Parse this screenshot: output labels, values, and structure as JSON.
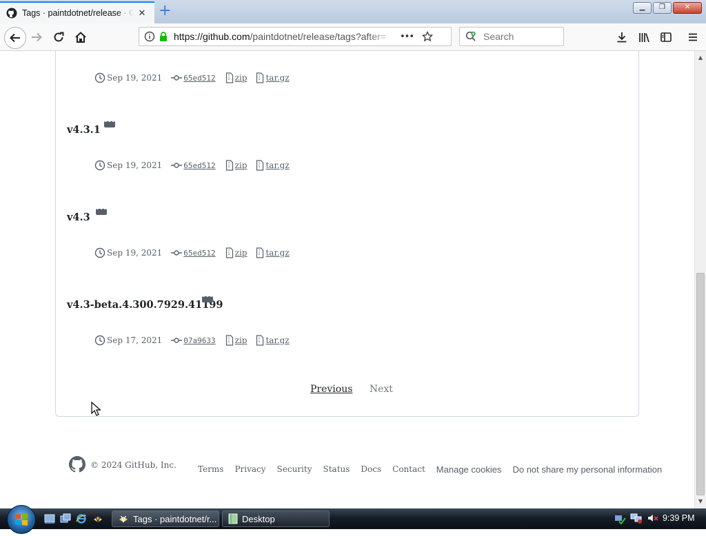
{
  "browser": {
    "tab_title": "Tags · paintdotnet/release · GitHub",
    "tab_close": "✕",
    "new_tab": "+",
    "url_host": "https://github.com",
    "url_path": "/paintdotnet/release/tags?after=",
    "url_more": "•••",
    "search_placeholder": "Search",
    "accent_color": "#0a84ff"
  },
  "window_controls": {
    "minimize": "▁",
    "maximize": "❐",
    "close": "✕"
  },
  "tags": [
    {
      "name": "",
      "date": "Sep 19, 2021",
      "sha": "65ed512",
      "zip": "zip",
      "targz": "tar.gz"
    },
    {
      "name": "v4.3.1",
      "date": "Sep 19, 2021",
      "sha": "65ed512",
      "zip": "zip",
      "targz": "tar.gz"
    },
    {
      "name": "v4.3",
      "date": "Sep 19, 2021",
      "sha": "65ed512",
      "zip": "zip",
      "targz": "tar.gz"
    },
    {
      "name": "v4.3-beta.4.300.7929.41199",
      "date": "Sep 17, 2021",
      "sha": "07a9633",
      "zip": "zip",
      "targz": "tar.gz"
    }
  ],
  "menu_dots": "•••",
  "pagination": {
    "previous": "Previous",
    "next": "Next"
  },
  "footer": {
    "copyright": "© 2024 GitHub, Inc.",
    "links": [
      "Terms",
      "Privacy",
      "Security",
      "Status",
      "Docs",
      "Contact",
      "Manage cookies",
      "Do not share my personal information"
    ]
  },
  "taskbar": {
    "active_task": "Tags · paintdotnet/r...",
    "desktop_task": "Desktop",
    "clock": "9:39 PM"
  }
}
